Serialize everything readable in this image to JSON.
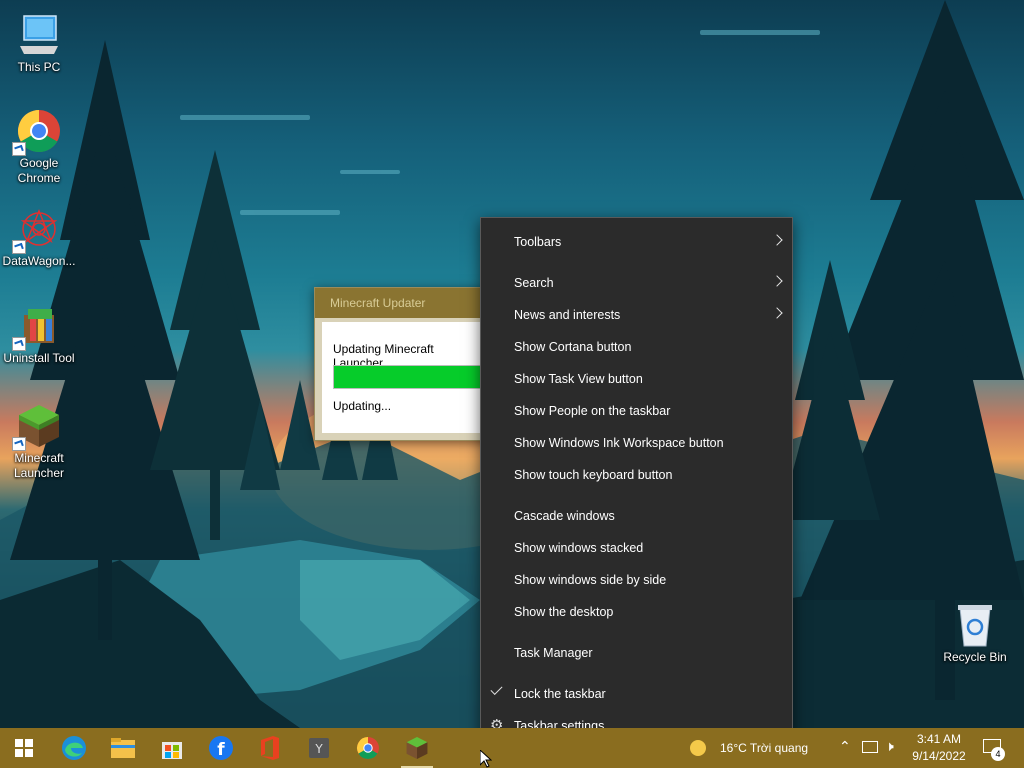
{
  "desktop": {
    "icons": [
      {
        "label": "This PC",
        "icon": "this-pc-icon"
      },
      {
        "label": "Google Chrome",
        "icon": "chrome-icon"
      },
      {
        "label": "DataWagon...",
        "icon": "datawagon-icon"
      },
      {
        "label": "Uninstall Tool",
        "icon": "uninstall-tool-icon"
      },
      {
        "label": "Minecraft Launcher",
        "icon": "minecraft-icon"
      },
      {
        "label": "Recycle Bin",
        "icon": "recycle-bin-icon"
      }
    ]
  },
  "updater": {
    "title": "Minecraft Updater",
    "message": "Updating Minecraft Launcher...",
    "progress": 1.0,
    "status": "Updating..."
  },
  "context_menu": {
    "items": [
      {
        "label": "Toolbars",
        "submenu": true
      },
      {
        "label": "Search",
        "submenu": true
      },
      {
        "label": "News and interests",
        "submenu": true
      },
      {
        "label": "Show Cortana button"
      },
      {
        "label": "Show Task View button"
      },
      {
        "label": "Show People on the taskbar"
      },
      {
        "label": "Show Windows Ink Workspace button"
      },
      {
        "label": "Show touch keyboard button"
      },
      {
        "label": "Cascade windows"
      },
      {
        "label": "Show windows stacked"
      },
      {
        "label": "Show windows side by side"
      },
      {
        "label": "Show the desktop"
      },
      {
        "label": "Task Manager"
      },
      {
        "label": "Lock the taskbar",
        "checked": true
      },
      {
        "label": "Taskbar settings",
        "icon": "gear-icon"
      }
    ]
  },
  "taskbar": {
    "apps": [
      "windows-start-icon",
      "edge-icon",
      "file-explorer-icon",
      "store-icon",
      "facebook-icon",
      "office-icon",
      "yandex-icon",
      "chrome-icon",
      "minecraft-icon"
    ],
    "weather": "16°C  Trời quang",
    "clock": {
      "time": "3:41 AM",
      "date": "9/14/2022"
    },
    "notification_count": "4"
  },
  "colors": {
    "taskbar": "#8a6d1f",
    "menu_bg": "#2b2b2b",
    "progress": "#06cc2a"
  }
}
